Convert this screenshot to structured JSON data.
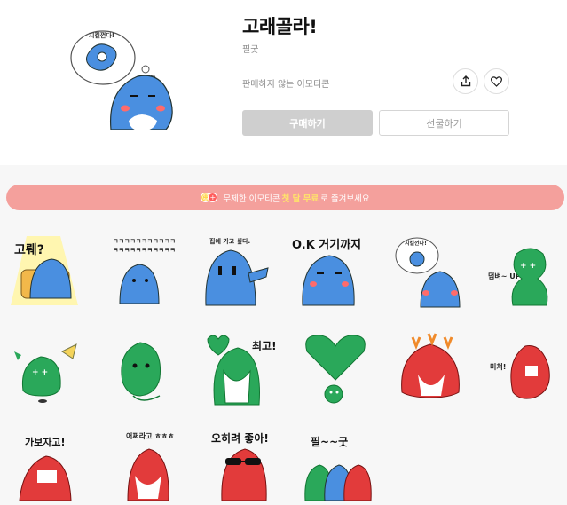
{
  "product": {
    "title": "고래골라!",
    "author": "필굿",
    "note": "판매하지 않는 이모티콘",
    "buy_label": "구매하기",
    "gift_label": "선물하기",
    "hero_caption": "지킬껀다!"
  },
  "actions": {
    "share_icon": "share-icon",
    "like_icon": "heart-icon"
  },
  "banner": {
    "prefix": "무제한 이모티콘",
    "highlight": "첫 달 무료",
    "suffix": "로 즐겨보세요",
    "badge_a": "☺",
    "badge_b": "+"
  },
  "stickers": [
    {
      "caption": "고뤠?",
      "color": "#4a8fe0"
    },
    {
      "caption": "ㅋㅋㅋㅋㅋㅋㅋㅋㅋㅋㅋ",
      "color": "#4a8fe0"
    },
    {
      "caption": "집에 가고 싶다.",
      "color": "#4a8fe0"
    },
    {
      "caption": "O.K 거기까지",
      "color": "#4a8fe0"
    },
    {
      "caption": "지킬껀다!",
      "color": "#4a8fe0"
    },
    {
      "caption": "덤벼~ UP",
      "color": "#2aa85a"
    },
    {
      "caption": "",
      "color": "#2aa85a"
    },
    {
      "caption": "",
      "color": "#2aa85a"
    },
    {
      "caption": "최고!",
      "color": "#2aa85a"
    },
    {
      "caption": "",
      "color": "#2aa85a"
    },
    {
      "caption": "",
      "color": "#e23b3b"
    },
    {
      "caption": "미쳐!",
      "color": "#e23b3b"
    },
    {
      "caption": "가보자고!",
      "color": "#e23b3b"
    },
    {
      "caption": "어쩌라고 ㅎㅎㅎ",
      "color": "#e23b3b"
    },
    {
      "caption": "오히려 좋아!",
      "color": "#e23b3b"
    },
    {
      "caption": "필~~굿",
      "color": "#4a8fe0"
    }
  ]
}
